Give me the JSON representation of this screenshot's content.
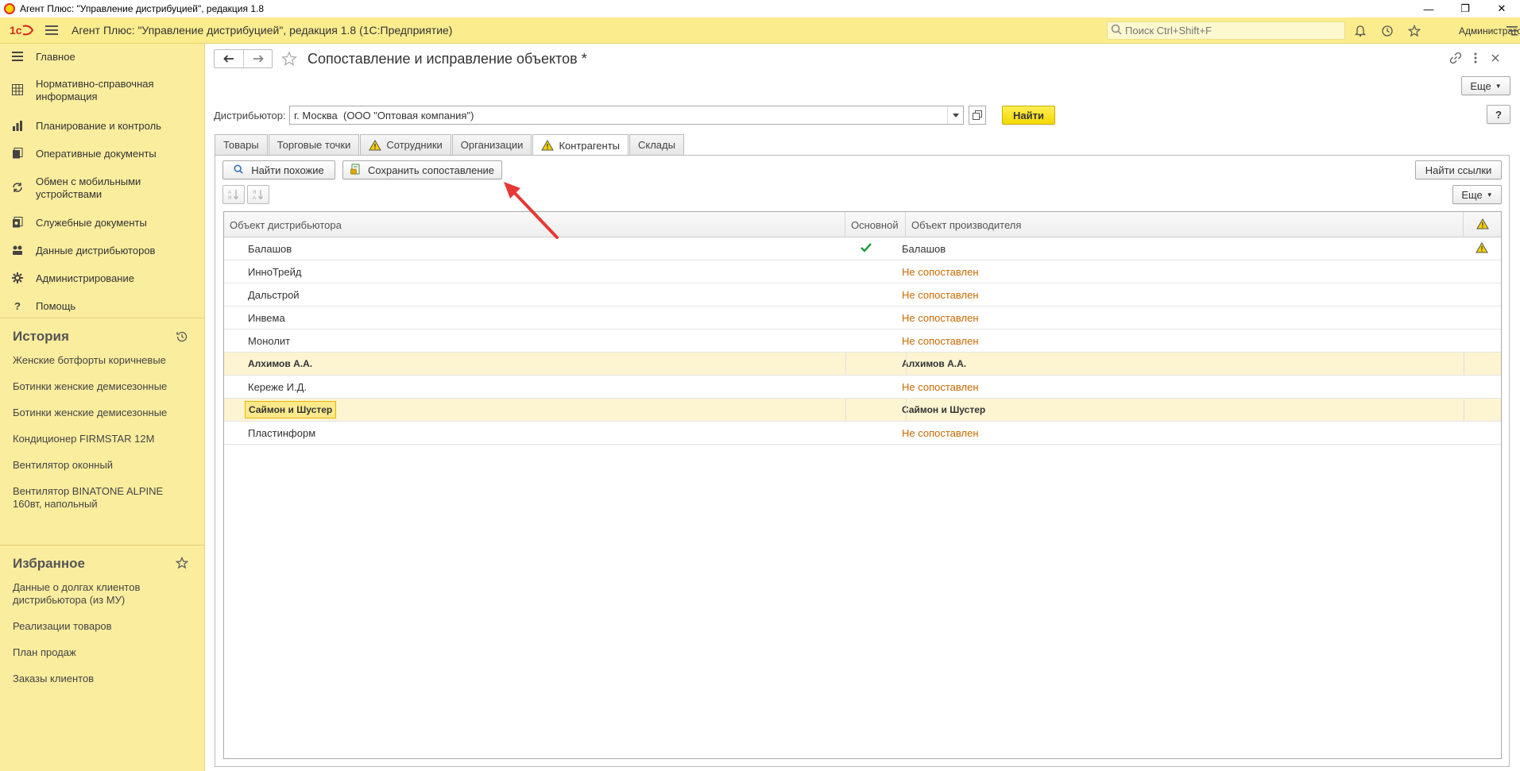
{
  "window": {
    "title": "Агент Плюс: \"Управление дистрибуцией\", редакция 1.8"
  },
  "header": {
    "app_title": "Агент Плюс: \"Управление дистрибуцией\", редакция 1.8  (1С:Предприятие)",
    "search_placeholder": "Поиск Ctrl+Shift+F",
    "user": "Администратор"
  },
  "sidebar": {
    "nav": [
      {
        "label": "Главное",
        "icon": "menu-lines-icon"
      },
      {
        "label": "Нормативно-справочная информация",
        "icon": "grid-book-icon"
      },
      {
        "label": "Планирование и контроль",
        "icon": "bar-chart-icon"
      },
      {
        "label": "Оперативные документы",
        "icon": "documents-icon"
      },
      {
        "label": "Обмен с мобильными устройствами",
        "icon": "sync-icon"
      },
      {
        "label": "Служебные документы",
        "icon": "service-docs-icon"
      },
      {
        "label": "Данные дистрибьюторов",
        "icon": "distributors-icon"
      },
      {
        "label": "Администрирование",
        "icon": "gear-icon"
      },
      {
        "label": "Помощь",
        "icon": "help-icon"
      }
    ],
    "history_title": "История",
    "history": [
      "Женские ботфорты коричневые",
      "Ботинки женские демисезонные",
      "Ботинки женские демисезонные",
      "Кондиционер FIRMSTAR 12M",
      "Вентилятор оконный",
      "Вентилятор BINATONE ALPINE 160вт, напольный"
    ],
    "favorites_title": "Избранное",
    "favorites": [
      "Данные о долгах клиентов дистрибьютора (из МУ)",
      "Реализации товаров",
      "План продаж",
      "Заказы клиентов"
    ]
  },
  "form": {
    "title": "Сопоставление и исправление объектов *",
    "more_label": "Еще",
    "help_label": "?",
    "distributor_label": "Дистрибьютор:",
    "distributor_value": "г. Москва  (ООО \"Оптовая компания\")",
    "find_label": "Найти",
    "tabs": [
      {
        "label": "Товары",
        "warning": false
      },
      {
        "label": "Торговые точки",
        "warning": false
      },
      {
        "label": "Сотрудники",
        "warning": true
      },
      {
        "label": "Организации",
        "warning": false
      },
      {
        "label": "Контрагенты",
        "warning": true,
        "active": true
      },
      {
        "label": "Склады",
        "warning": false
      }
    ],
    "find_similar_label": "Найти похожие",
    "save_mapping_label": "Сохранить сопоставление",
    "find_links_label": "Найти ссылки",
    "table_more_label": "Еще",
    "columns": {
      "distributor_object": "Объект дистрибьютора",
      "main": "Основной",
      "producer_object": "Объект производителя"
    },
    "rows": [
      {
        "distributor": "Балашов",
        "main": true,
        "producer": "Балашов",
        "status": "matched",
        "warning": true
      },
      {
        "distributor": "ИнноТрейд",
        "main": false,
        "producer": "Не сопоставлен",
        "status": "not_matched"
      },
      {
        "distributor": "Дальстрой",
        "main": false,
        "producer": "Не сопоставлен",
        "status": "not_matched"
      },
      {
        "distributor": "Инвема",
        "main": false,
        "producer": "Не сопоставлен",
        "status": "not_matched"
      },
      {
        "distributor": "Монолит",
        "main": false,
        "producer": "Не сопоставлен",
        "status": "not_matched"
      },
      {
        "distributor": "Алхимов А.А.",
        "main": false,
        "producer": "Алхимов А.А.",
        "status": "group"
      },
      {
        "distributor": "Кереже И.Д.",
        "main": false,
        "producer": "Не сопоставлен",
        "status": "not_matched"
      },
      {
        "distributor": "Саймон и Шустер",
        "main": false,
        "producer": "Саймон и Шустер",
        "status": "group",
        "selected": true
      },
      {
        "distributor": "Пластинформ",
        "main": false,
        "producer": "Не сопоставлен",
        "status": "not_matched"
      }
    ]
  },
  "colors": {
    "header_bg": "#fbec8e",
    "sidebar_bg": "#fbed9e",
    "accent_button": "#f5d800",
    "not_matched_text": "#c76a00",
    "check_green": "#1a9a3c",
    "arrow_red": "#e53935"
  }
}
